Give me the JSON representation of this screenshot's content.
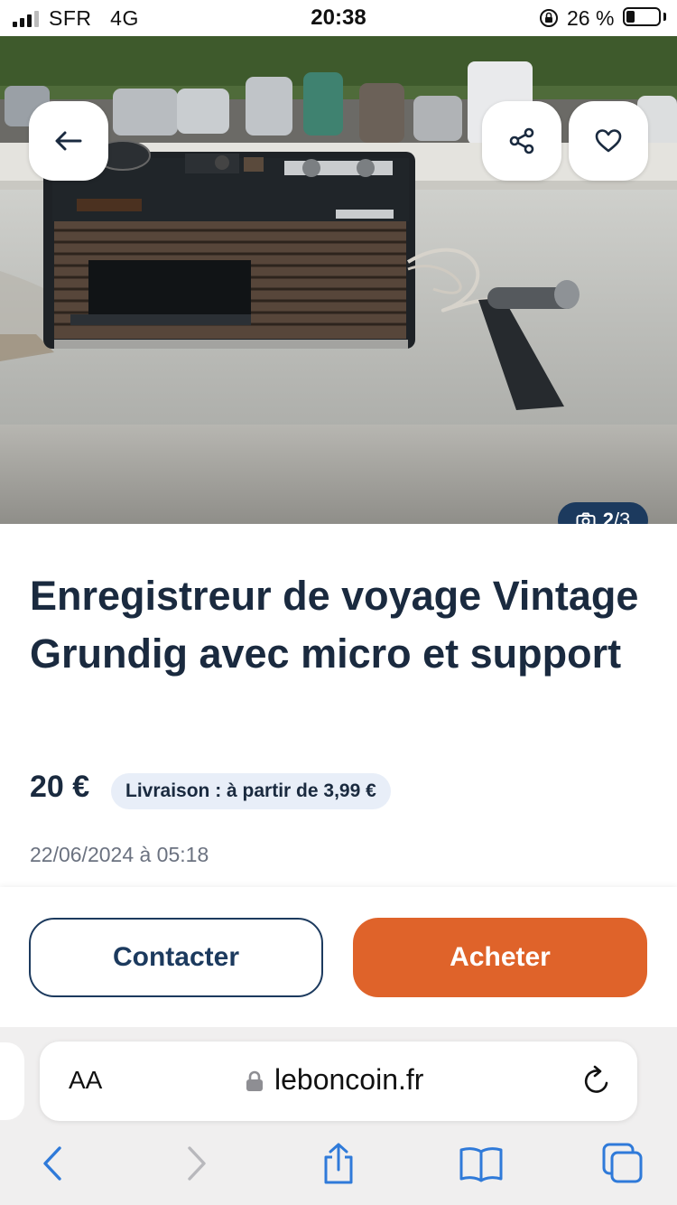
{
  "status_bar": {
    "carrier": "SFR",
    "network": "4G",
    "time": "20:38",
    "battery_percent": "26 %",
    "battery_level": 0.26
  },
  "photo": {
    "counter_current": "2",
    "counter_total": "/3"
  },
  "listing": {
    "title": "Enregistreur de voyage Vintage Grundig avec micro et support",
    "price": "20 €",
    "delivery": "Livraison : à partir de 3,99 €",
    "date": "22/06/2024 à 05:18"
  },
  "actions": {
    "contact_label": "Contacter",
    "buy_label": "Acheter"
  },
  "browser": {
    "text_size_label": "AA",
    "url": "leboncoin.fr"
  },
  "colors": {
    "navy": "#1c3a5e",
    "orange": "#df632a",
    "ios_blue": "#2f7ad9"
  },
  "icons": [
    "back-arrow-icon",
    "share-icon",
    "heart-icon",
    "camera-icon",
    "lock-icon",
    "reload-icon",
    "back-chevron-icon",
    "forward-chevron-icon",
    "share-upload-icon",
    "bookmarks-icon",
    "tabs-icon"
  ]
}
